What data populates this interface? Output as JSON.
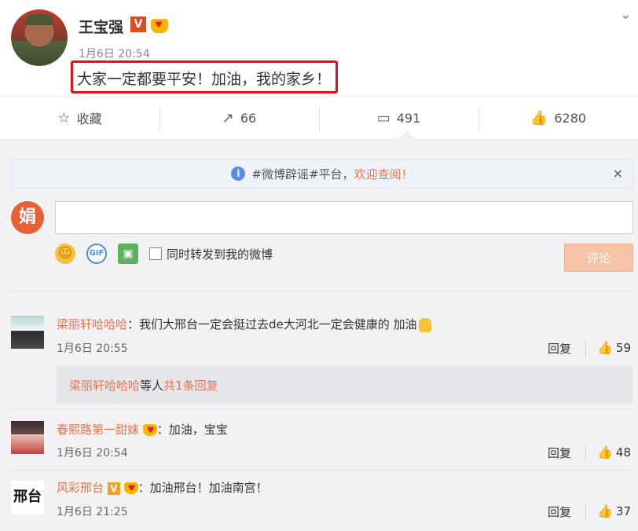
{
  "post": {
    "author": "王宝强",
    "verified_badge": "V",
    "time": "1月6日 20:54",
    "text": "大家一定都要平安！加油，我的家乡！",
    "highlight_color": "#e2101a"
  },
  "actions": {
    "favorite": "收藏",
    "repost_count": "66",
    "comment_count": "491",
    "like_count": "6280"
  },
  "notice": {
    "tag_text": "#微博辟谣#平台，",
    "link_text": "欢迎查阅！",
    "close": "×"
  },
  "composer": {
    "my_avatar_glyph": "娟",
    "input_value": "",
    "repost_label": "同时转发到我的微博",
    "submit_label": "评论",
    "gif_label": "GIF"
  },
  "comments": [
    {
      "name": "梁丽轩哈哈哈",
      "text": "：我们大邢台一定会挺过去de大河北一定会健康的  加油",
      "time": "1月6日 20:55",
      "reply_label": "回复",
      "likes": "59"
    },
    {
      "name": "春熙路第一甜妹",
      "text": "：加油，宝宝",
      "time": "1月6日 20:54",
      "reply_label": "回复",
      "likes": "48"
    },
    {
      "name": "风彩邢台",
      "text": "：加油邢台！加油南宫！",
      "time": "1月6日 21:25",
      "reply_label": "回复",
      "likes": "37",
      "avatar_text": "邢台"
    }
  ],
  "sub_reply": {
    "name": "梁丽轩哈哈哈",
    "middle": " 等人 ",
    "more": "共1条回复"
  },
  "colors": {
    "accent": "#eb7350",
    "submit_disabled": "#f8c4a7",
    "info_blue": "#5a8de0"
  }
}
